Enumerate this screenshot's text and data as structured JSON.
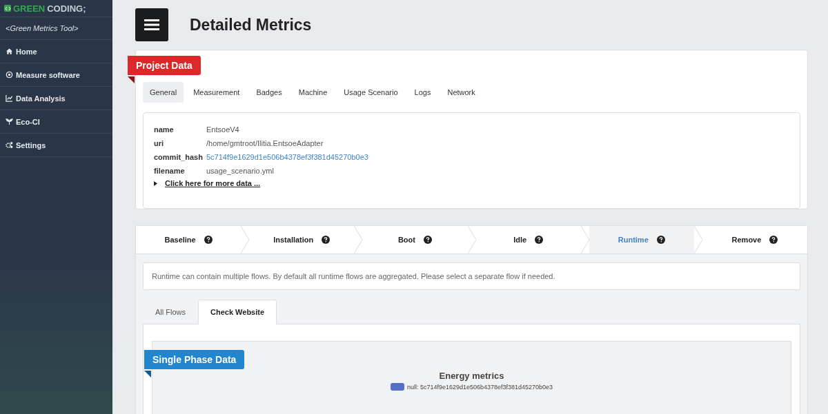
{
  "sidebar": {
    "logo": {
      "brand_first": "GREEN",
      "brand_second": "CODING;"
    },
    "subtitle": "<Green Metrics Tool>",
    "items": [
      {
        "label": "Home"
      },
      {
        "label": "Measure software"
      },
      {
        "label": "Data Analysis"
      },
      {
        "label": "Eco-CI"
      },
      {
        "label": "Settings"
      }
    ]
  },
  "header": {
    "title": "Detailed Metrics"
  },
  "project": {
    "ribbon": "Project Data",
    "tabs": [
      {
        "label": "General",
        "selected": true
      },
      {
        "label": "Measurement",
        "selected": false
      },
      {
        "label": "Badges",
        "selected": false
      },
      {
        "label": "Machine",
        "selected": false
      },
      {
        "label": "Usage Scenario",
        "selected": false
      },
      {
        "label": "Logs",
        "selected": false
      },
      {
        "label": "Network",
        "selected": false
      }
    ],
    "fields": [
      {
        "key": "name",
        "value": "EntsoeV4",
        "kind": "text"
      },
      {
        "key": "uri",
        "value": "/home/gmtroot/Ilitia.EntsoeAdapter",
        "kind": "text"
      },
      {
        "key": "commit_hash",
        "value": "5c714f9e1629d1e506b4378ef3f381d45270b0e3",
        "kind": "link"
      },
      {
        "key": "filename",
        "value": "usage_scenario.yml",
        "kind": "text"
      }
    ],
    "more_link": "Click here for more data ..."
  },
  "phases": [
    {
      "label": "Baseline",
      "selected": false
    },
    {
      "label": "Installation",
      "selected": false
    },
    {
      "label": "Boot",
      "selected": false
    },
    {
      "label": "Idle",
      "selected": false
    },
    {
      "label": "Runtime",
      "selected": true
    },
    {
      "label": "Remove",
      "selected": false
    }
  ],
  "runtime_note": "Runtime can contain multiple flows. By default all runtime flows are aggregated. Please select a separate flow if needed.",
  "flow_tabs": [
    {
      "label": "All Flows",
      "selected": false
    },
    {
      "label": "Check Website",
      "selected": true
    }
  ],
  "single_phase": {
    "ribbon": "Single Phase Data",
    "chart_title": "Energy metrics",
    "legend": [
      {
        "label": "null: 5c714f9e1629d1e506b4378ef3f381d45270b0e3",
        "color": "#5470c6"
      }
    ]
  }
}
